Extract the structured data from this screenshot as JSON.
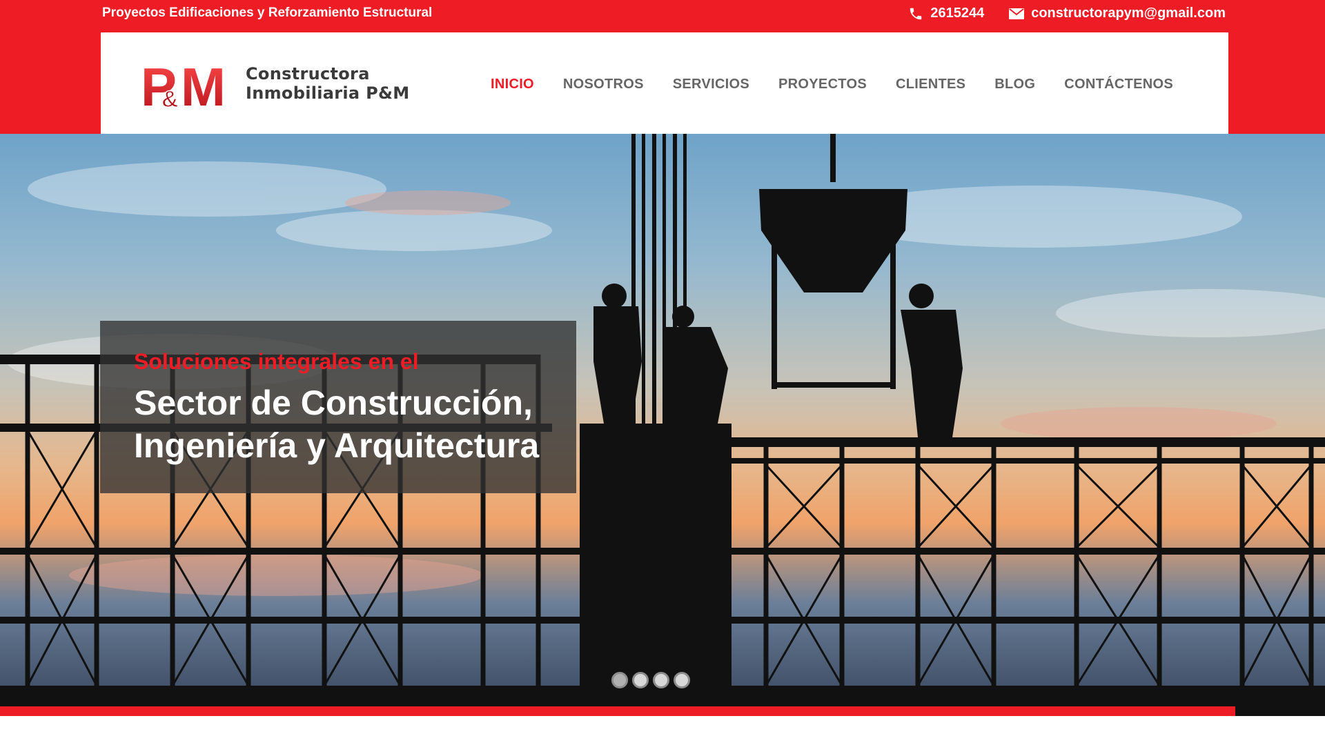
{
  "topbar": {
    "tagline": "Proyectos Edificaciones y Reforzamiento Estructural",
    "phone": "2615244",
    "email": "constructorapym@gmail.com",
    "phone_icon": "phone-icon",
    "email_icon": "envelope-icon"
  },
  "logo": {
    "mark": "P&M",
    "line1": "Constructora",
    "line2": "Inmobiliaria P&M"
  },
  "nav": {
    "items": [
      {
        "label": "INICIO",
        "active": true
      },
      {
        "label": "NOSOTROS"
      },
      {
        "label": "SERVICIOS"
      },
      {
        "label": "PROYECTOS"
      },
      {
        "label": "CLIENTES"
      },
      {
        "label": "BLOG"
      },
      {
        "label": "CONTÁCTENOS"
      }
    ]
  },
  "hero": {
    "subtitle": "Soluciones integrales en el",
    "title_line1": "Sector de Construcción,",
    "title_line2": "Ingeniería y Arquitectura",
    "slides_total": 4,
    "slide_active": 1
  },
  "colors": {
    "brand_red": "#ee1c25",
    "nav_text": "#666666"
  }
}
